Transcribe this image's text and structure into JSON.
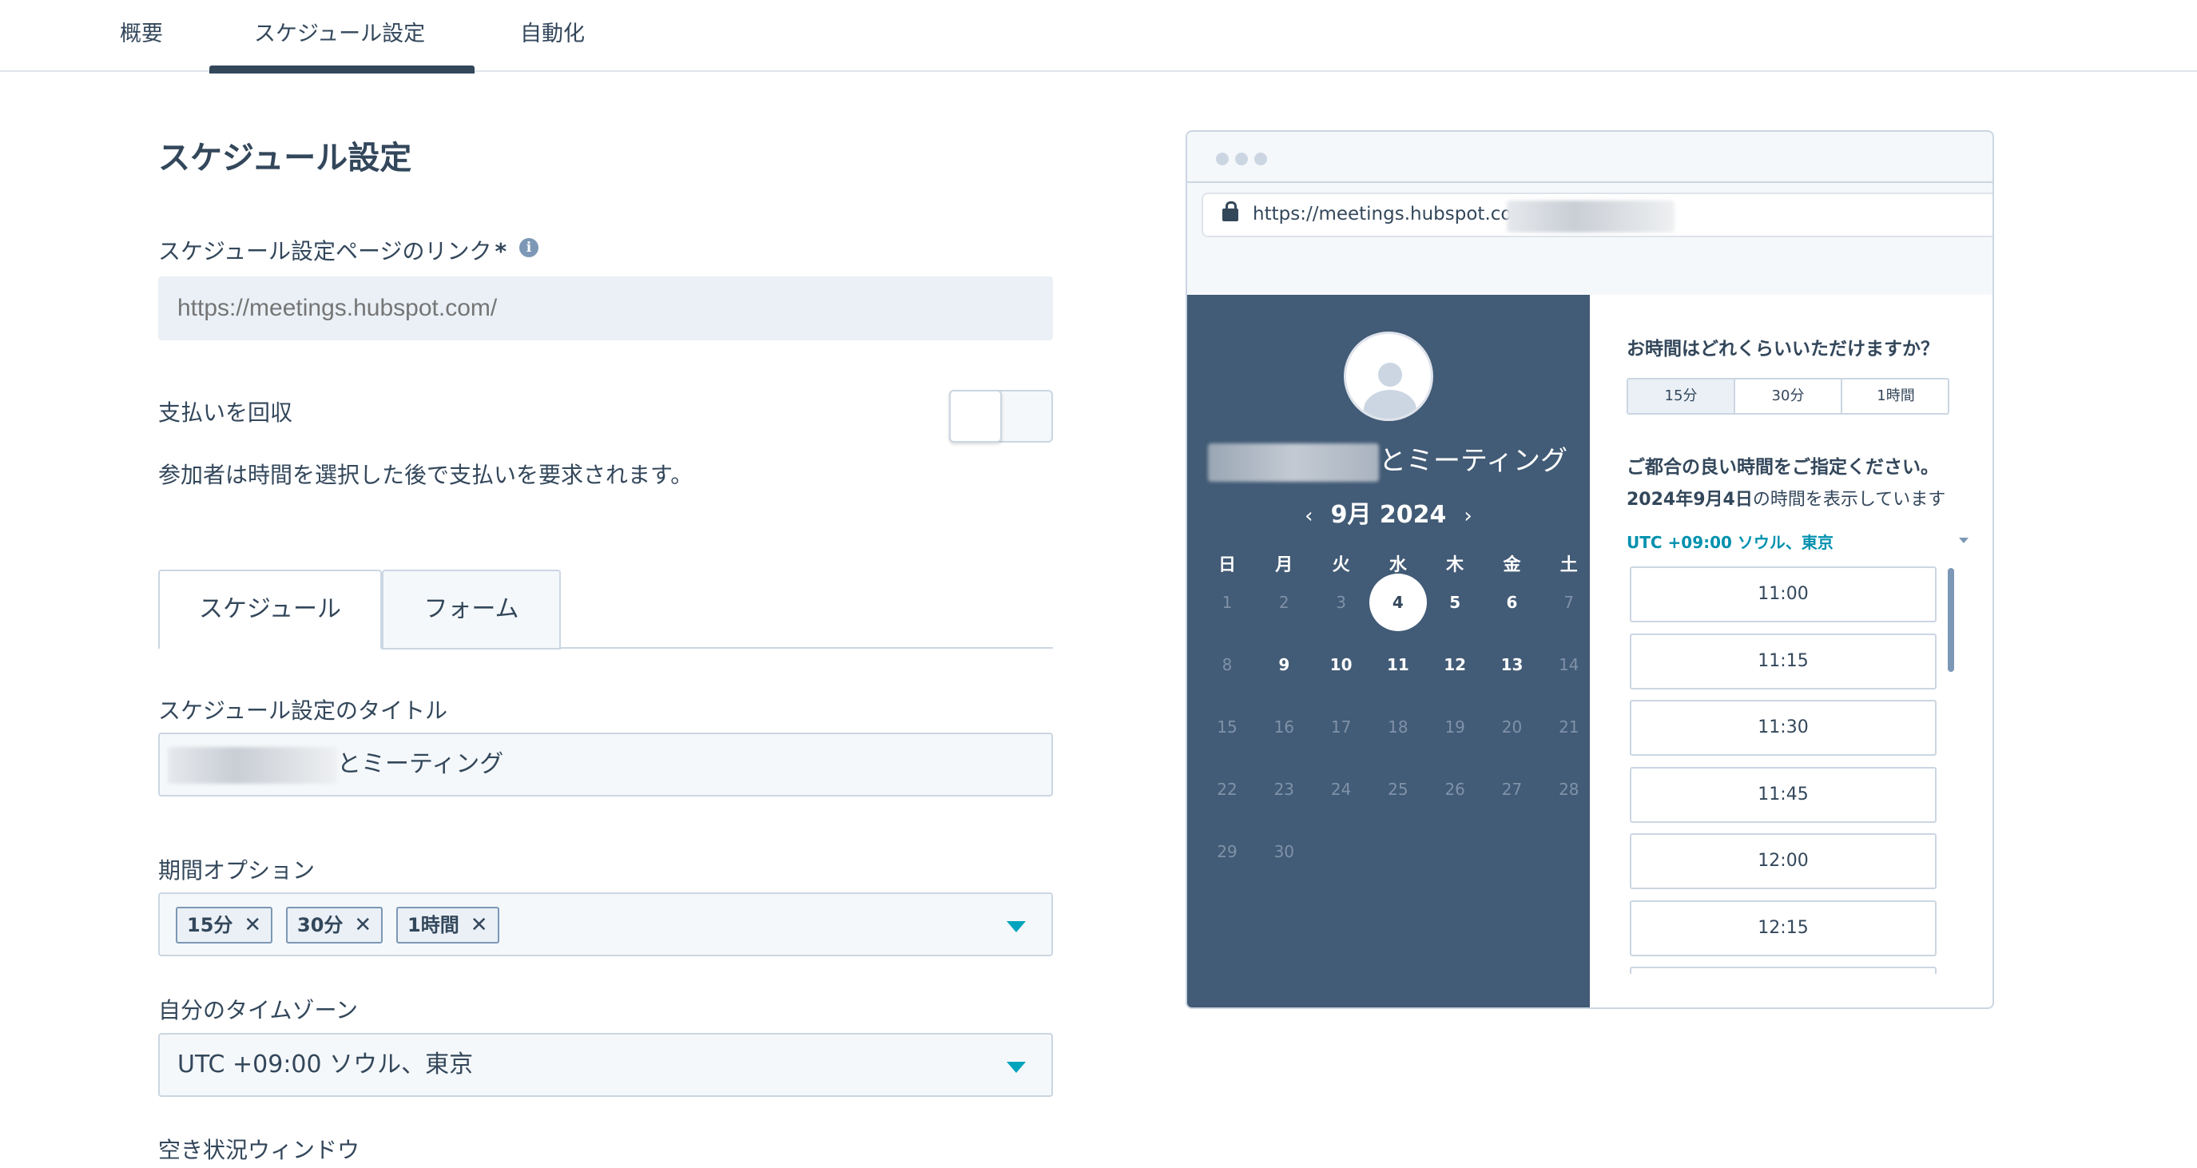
{
  "top_tabs": [
    {
      "label": "概要"
    },
    {
      "label": "スケジュール設定"
    },
    {
      "label": "自動化"
    }
  ],
  "page_title": "スケジュール設定",
  "link_field": {
    "label": "スケジュール設定ページのリンク",
    "required_mark": "*",
    "placeholder": "https://meetings.hubspot.com/"
  },
  "payment": {
    "label": "支払いを回収",
    "description": "参加者は時間を選択した後で支払いを要求されます。",
    "enabled": false
  },
  "inner_tabs": [
    {
      "label": "スケジュール"
    },
    {
      "label": "フォーム"
    }
  ],
  "title_field": {
    "label": "スケジュール設定のタイトル",
    "value_suffix": "とミーティング"
  },
  "duration_field": {
    "label": "期間オプション",
    "chips": [
      "15分",
      "30分",
      "1時間"
    ],
    "remove_glyph": "✕"
  },
  "timezone_field": {
    "label": "自分のタイムゾーン",
    "value": "UTC +09:00 ソウル、東京"
  },
  "availability_label": "空き状況ウィンドウ",
  "preview": {
    "url": "https://meetings.hubspot.com/",
    "calendar": {
      "title_suffix": "とミーティング",
      "month": "9月 2024",
      "prev": "‹",
      "next": "›",
      "weekdays": [
        "日",
        "月",
        "火",
        "水",
        "木",
        "金",
        "土"
      ],
      "days": [
        [
          1,
          2,
          3,
          4,
          5,
          6,
          7
        ],
        [
          8,
          9,
          10,
          11,
          12,
          13,
          14
        ],
        [
          15,
          16,
          17,
          18,
          19,
          20,
          21
        ],
        [
          22,
          23,
          24,
          25,
          26,
          27,
          28
        ],
        [
          29,
          30
        ]
      ],
      "available_days": [
        5,
        6,
        9,
        10,
        11,
        12,
        13
      ],
      "selected_day": 4
    },
    "time_panel": {
      "question": "お時間はどれくらいいただけますか？",
      "durations": [
        "15分",
        "30分",
        "1時間"
      ],
      "selected_duration": "15分",
      "prompt": "ご都合の良い時間をご指定ください。",
      "date_bold": "2024年9月4日",
      "date_rest": "の時間を表示しています",
      "timezone": "UTC +09:00 ソウル、東京",
      "slots": [
        "11:00",
        "11:15",
        "11:30",
        "11:45",
        "12:00",
        "12:15"
      ]
    }
  },
  "colors": {
    "text": "#33475b",
    "calendar_bg": "#425b76",
    "accent": "#00a4bd",
    "link": "#0091ae",
    "border": "#cbd6e2"
  }
}
